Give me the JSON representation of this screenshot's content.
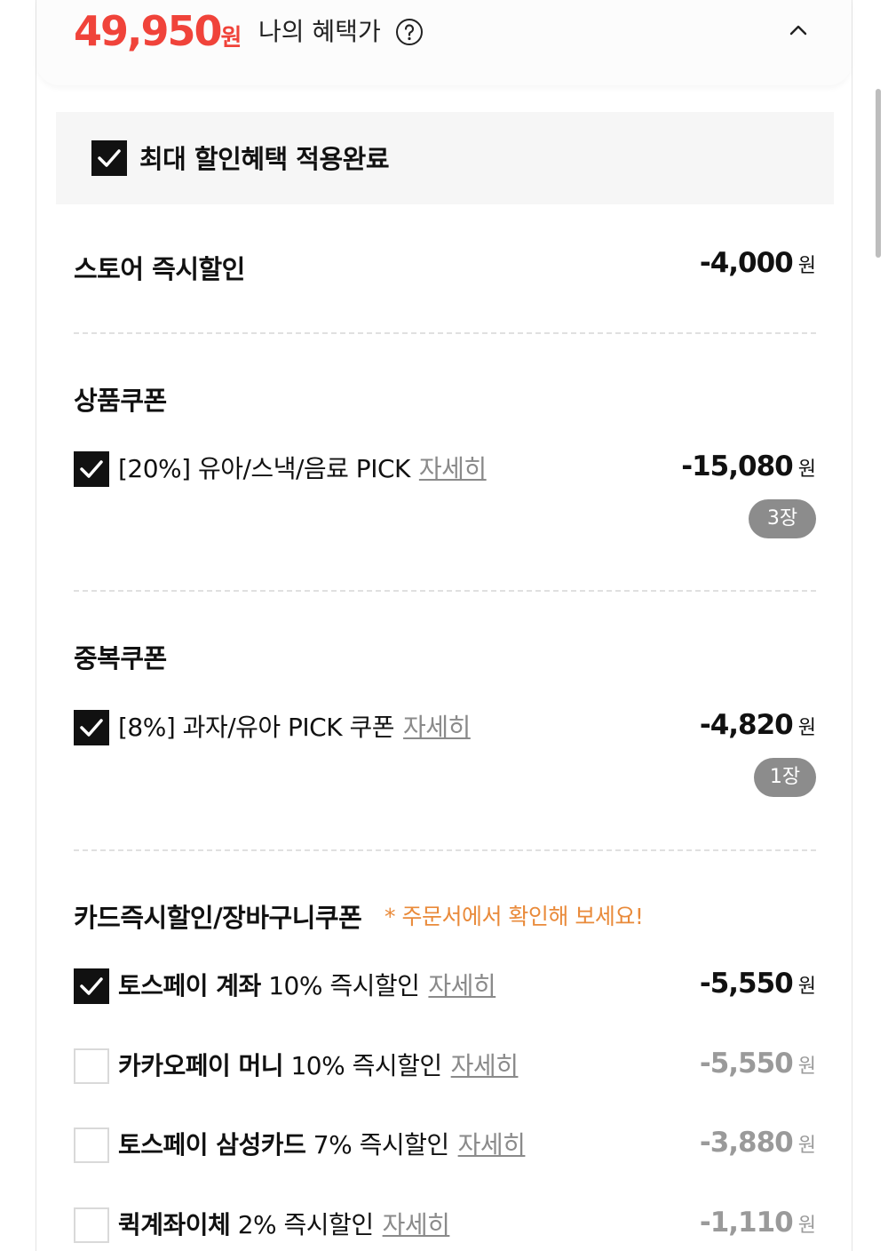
{
  "header": {
    "price": "49,950",
    "price_unit": "원",
    "benefit_label": "나의 혜택가",
    "help_icon": "question-circle-icon",
    "collapse_icon": "chevron-up-icon"
  },
  "max_discount": {
    "label": "최대 할인혜택 적용완료",
    "checked": true
  },
  "store_discount": {
    "title": "스토어 즉시할인",
    "amount": "-4,000",
    "unit": "원"
  },
  "product_coupon": {
    "title": "상품쿠폰",
    "item": {
      "text": "[20%] 유아/스낵/음료 PICK",
      "link": "자세히",
      "amount": "-15,080",
      "unit": "원",
      "count": "3장",
      "checked": true
    }
  },
  "duplicate_coupon": {
    "title": "중복쿠폰",
    "item": {
      "text": "[8%] 과자/유아 PICK 쿠폰",
      "link": "자세히",
      "amount": "-4,820",
      "unit": "원",
      "count": "1장",
      "checked": true
    }
  },
  "card_discount": {
    "title": "카드즉시할인/장바구니쿠폰",
    "note": "* 주문서에서 확인해 보세요!",
    "items": [
      {
        "name": "토스페이 계좌",
        "desc": "10% 즉시할인",
        "link": "자세히",
        "amount": "-5,550",
        "unit": "원",
        "checked": true
      },
      {
        "name": "카카오페이 머니",
        "desc": "10% 즉시할인",
        "link": "자세히",
        "amount": "-5,550",
        "unit": "원",
        "checked": false
      },
      {
        "name": "토스페이 삼성카드",
        "desc": "7% 즉시할인",
        "link": "자세히",
        "amount": "-3,880",
        "unit": "원",
        "checked": false
      },
      {
        "name": "퀵계좌이체",
        "desc": "2% 즉시할인",
        "link": "자세히",
        "amount": "-1,110",
        "unit": "원",
        "checked": false
      }
    ]
  },
  "colors": {
    "price_red": "#f0433a",
    "note_orange": "#e98a3a",
    "pill_gray": "#8c8c8c"
  }
}
